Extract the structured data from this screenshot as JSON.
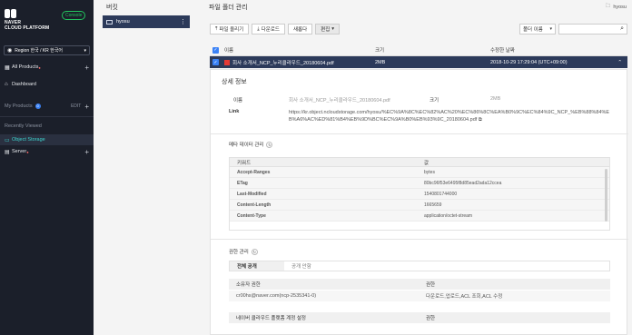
{
  "sidebar": {
    "brand": "NAVER\nCLOUD PLATFORM",
    "console_badge": "Console",
    "region": "Region 한국 / KR 한국어",
    "all_products": "All Products",
    "dashboard": "Dashboard",
    "my_products": "My Products",
    "my_products_count": "0",
    "edit": "EDIT",
    "recently_viewed": "Recently Viewed",
    "object_storage": "Object Storage",
    "server": "Server"
  },
  "bucket_panel": {
    "title": "버킷",
    "bucket_name": "hyosu"
  },
  "main": {
    "title": "파일 폴더 관리",
    "breadcrumb": "hyosu",
    "toolbar": {
      "upload": "파일 올리기",
      "download": "다운로드",
      "refresh": "새롭다",
      "edit": "편집"
    },
    "sort_label": "폴더 이름",
    "search_placeholder": "",
    "table": {
      "col_name": "이름",
      "col_size": "크기",
      "col_modified": "수정한 날짜",
      "row": {
        "name": "회사 소개서_NCP_누리클라우드_20180604.pdf",
        "size": "2MB",
        "modified": "2018-10-29 17:29:04 (UTC+09:00)"
      }
    },
    "detail": {
      "title": "상세 정보",
      "name_label": "이름",
      "name_value": "회사 소개서_NCP_누리클라우드_20180604.pdf",
      "size_label": "크기",
      "size_value": "2MB",
      "link_label": "Link",
      "link_line1": "https://kr.object.ncloudstorage.com/hyosu/%EC%9A%8C%EC%82%AC%20%EC%86%8C%EA%B0%9C%EC%84%9C_NCP_%EB%88%84%EB%A6%AC%ED%81%B4%EB%9D%BC%EC%9A%B0%EB%93%9C_20180604.pdf",
      "meta_title": "메타 데이터 관리",
      "meta_key_header": "키워드",
      "meta_value_header": "값",
      "meta_rows": [
        {
          "k": "Accept-Ranges",
          "v": "bytes"
        },
        {
          "k": "ETag",
          "v": "80bc96f53e6495f8d85ead2ada12ccea"
        },
        {
          "k": "Last-Modified",
          "v": "1540801744000"
        },
        {
          "k": "Content-Length",
          "v": "1665659"
        },
        {
          "k": "Content-Type",
          "v": "application/octet-stream"
        }
      ],
      "perm_title": "권한 관리",
      "public_label": "전체 공개",
      "public_value": "공개 안함",
      "owner_header": "소유자 권한",
      "owner_perm_header": "권한",
      "owner_value": "cr00hs@naver.com(ncp-2535341-0)",
      "owner_perm_value": "다운로드,업로드,ACL 조회,ACL 수정",
      "naver_account_header": "네이버 클라우드 플랫폼 계정 설정",
      "naver_perm_header": "권한"
    }
  },
  "colors": {
    "sidebar_bg": "#1b1f2a",
    "selected_row": "#2c3a5a",
    "accent_green": "#22c55e",
    "active_cyan": "#3dd6d0"
  }
}
